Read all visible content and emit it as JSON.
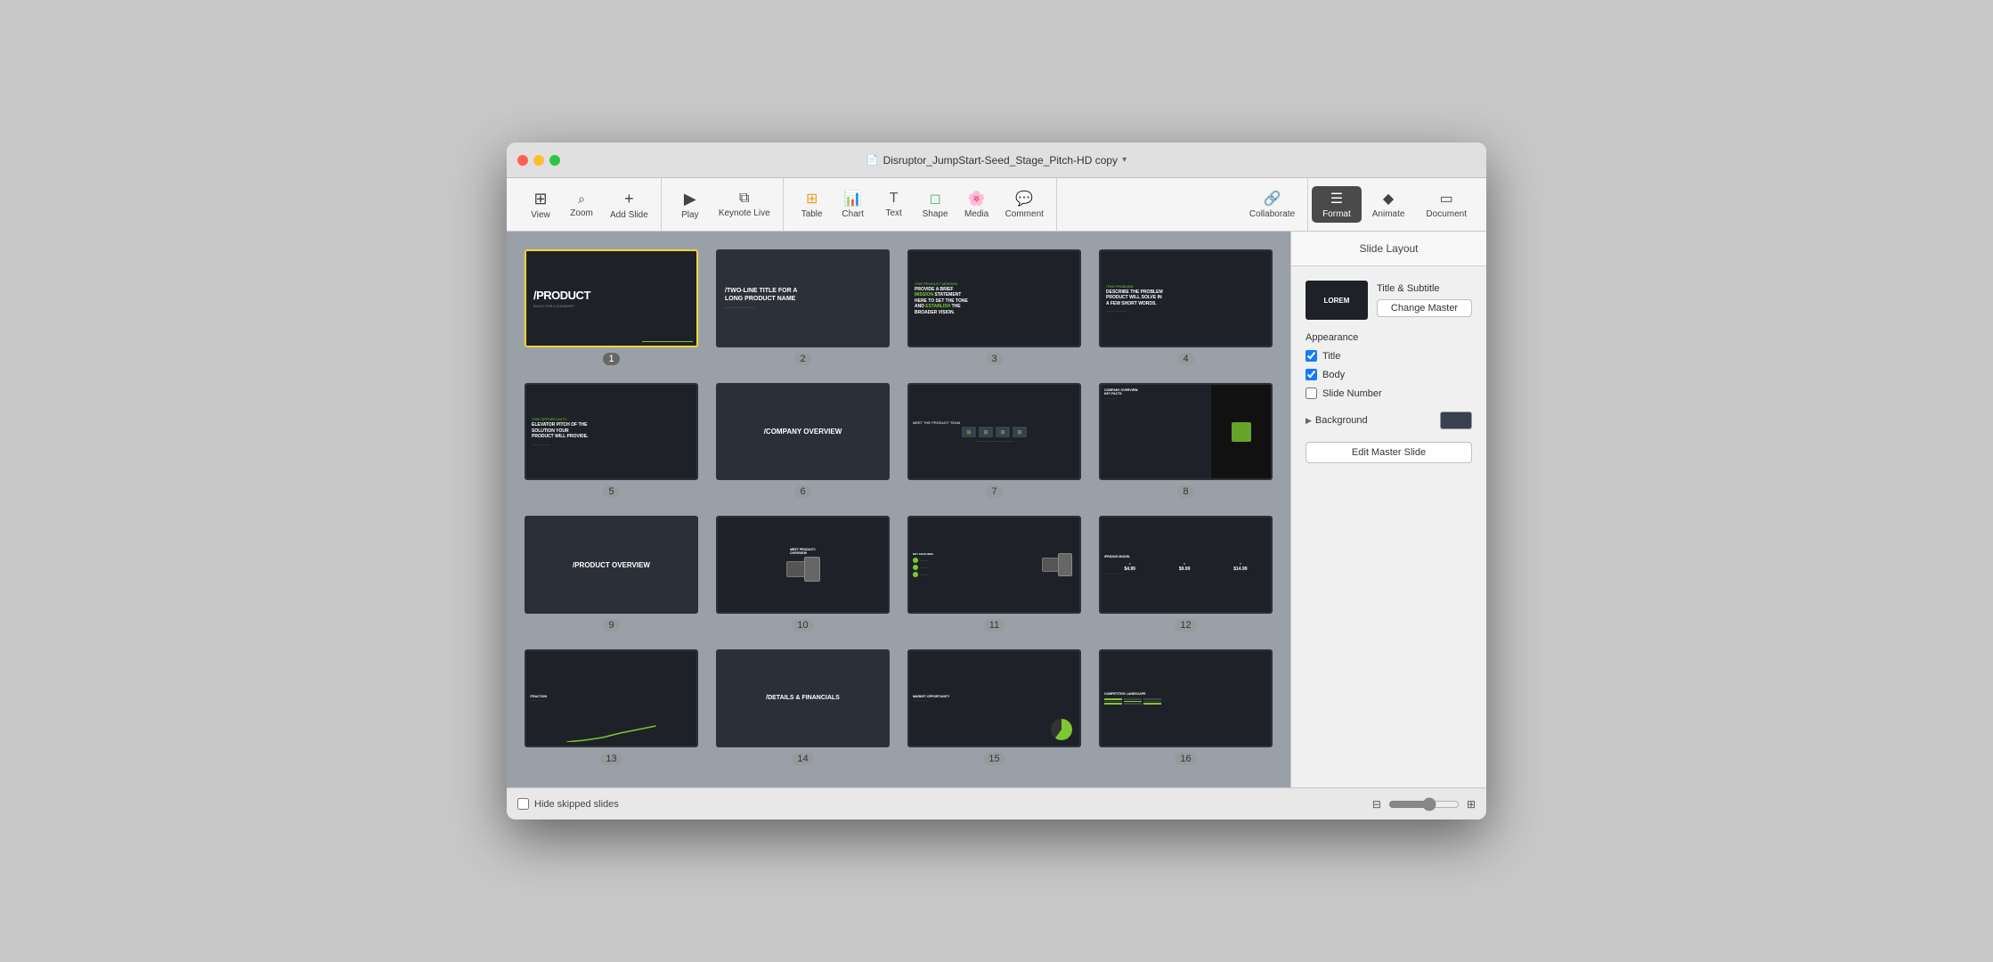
{
  "window": {
    "title": "Disruptor_JumpStart-Seed_Stage_Pitch-HD copy",
    "traffic_lights": [
      "red",
      "yellow",
      "green"
    ]
  },
  "toolbar": {
    "left_items": [
      {
        "id": "view",
        "label": "View",
        "icon": "⊞"
      },
      {
        "id": "zoom",
        "label": "Zoom",
        "icon": "⌕"
      },
      {
        "id": "add-slide",
        "label": "Add Slide",
        "icon": "+"
      }
    ],
    "center_items": [
      {
        "id": "play",
        "label": "Play",
        "icon": "▶"
      },
      {
        "id": "keynote-live",
        "label": "Keynote Live",
        "icon": "⧉"
      }
    ],
    "insert_items": [
      {
        "id": "table",
        "label": "Table",
        "icon": "⊞"
      },
      {
        "id": "chart",
        "label": "Chart",
        "icon": "📊"
      },
      {
        "id": "text",
        "label": "Text",
        "icon": "T"
      },
      {
        "id": "shape",
        "label": "Shape",
        "icon": "◻"
      },
      {
        "id": "media",
        "label": "Media",
        "icon": "🌸"
      },
      {
        "id": "comment",
        "label": "Comment",
        "icon": "💬"
      }
    ],
    "right_items": [
      {
        "id": "collaborate",
        "label": "Collaborate",
        "icon": "👤"
      },
      {
        "id": "format",
        "label": "Format",
        "icon": "☰",
        "active": true
      },
      {
        "id": "animate",
        "label": "Animate",
        "icon": "◆"
      },
      {
        "id": "document",
        "label": "Document",
        "icon": "▭"
      }
    ]
  },
  "slides": [
    {
      "number": 1,
      "selected": true,
      "type": "product-title"
    },
    {
      "number": 2,
      "selected": false,
      "type": "two-line-title"
    },
    {
      "number": 3,
      "selected": false,
      "type": "product-mission"
    },
    {
      "number": 4,
      "selected": false,
      "type": "the-problem"
    },
    {
      "number": 5,
      "selected": false,
      "type": "opportunity"
    },
    {
      "number": 6,
      "selected": false,
      "type": "company-overview"
    },
    {
      "number": 7,
      "selected": false,
      "type": "meet-team"
    },
    {
      "number": 8,
      "selected": false,
      "type": "company-overview-facts"
    },
    {
      "number": 9,
      "selected": false,
      "type": "product-overview"
    },
    {
      "number": 10,
      "selected": false,
      "type": "meet-product"
    },
    {
      "number": 11,
      "selected": false,
      "type": "key-features"
    },
    {
      "number": 12,
      "selected": false,
      "type": "pricing-model"
    },
    {
      "number": 13,
      "selected": false,
      "type": "traction"
    },
    {
      "number": 14,
      "selected": false,
      "type": "details-financials"
    },
    {
      "number": 15,
      "selected": false,
      "type": "market-opportunity"
    },
    {
      "number": 16,
      "selected": false,
      "type": "competitive-landscape"
    }
  ],
  "sidebar": {
    "header": "Slide Layout",
    "master_name": "Title & Subtitle",
    "change_master_label": "Change Master",
    "appearance_label": "Appearance",
    "checkboxes": [
      {
        "id": "title",
        "label": "Title",
        "checked": true
      },
      {
        "id": "body",
        "label": "Body",
        "checked": true
      },
      {
        "id": "slide-number",
        "label": "Slide Number",
        "checked": false
      }
    ],
    "background_label": "Background",
    "edit_master_label": "Edit Master Slide"
  },
  "bottom_bar": {
    "hide_skipped_label": "Hide skipped slides"
  }
}
